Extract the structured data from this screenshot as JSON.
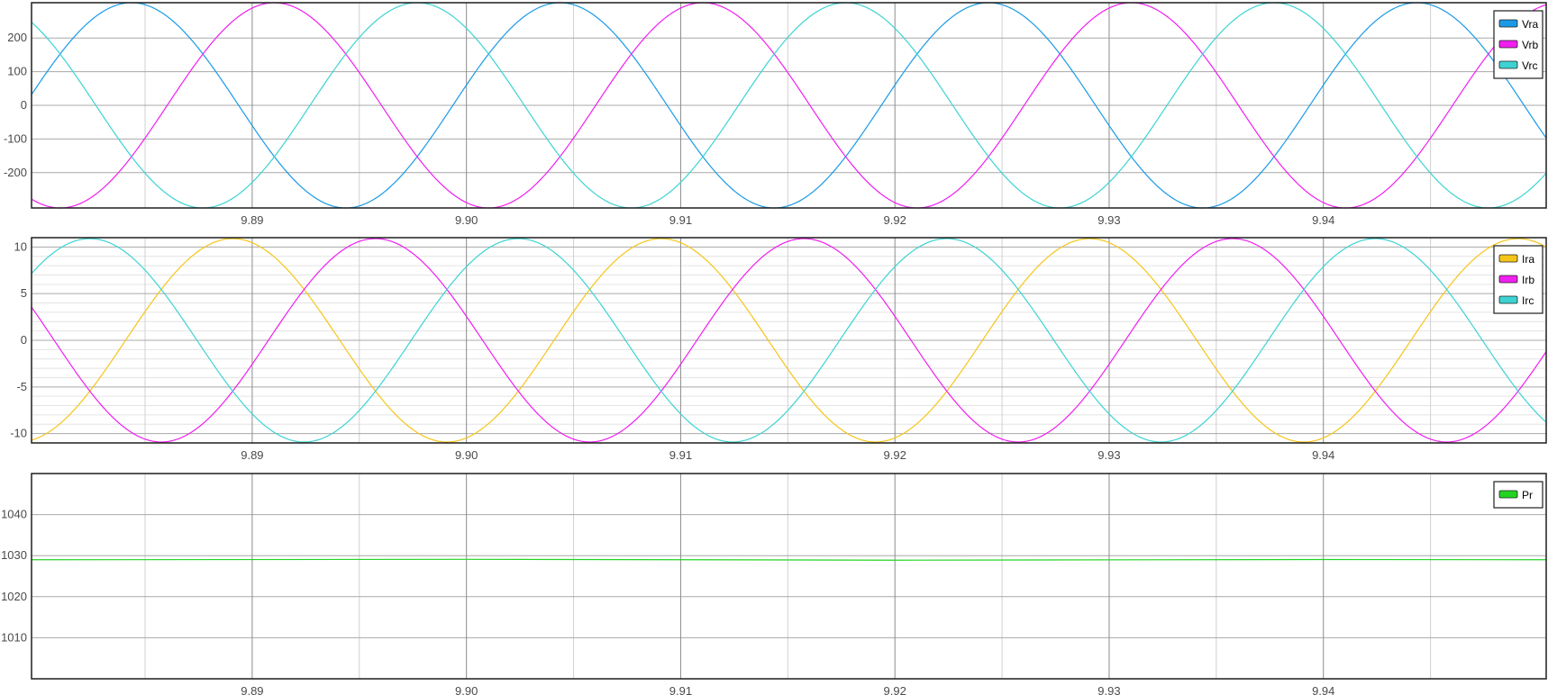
{
  "chart_data": [
    {
      "type": "line",
      "x_range": [
        9.8797,
        9.9504
      ],
      "x_ticks": [
        9.89,
        9.9,
        9.91,
        9.92,
        9.93,
        9.94
      ],
      "x_tick_labels": [
        "9.89",
        "9.90",
        "9.91",
        "9.92",
        "9.93",
        "9.94"
      ],
      "ylim": [
        -305,
        305
      ],
      "y_ticks": [
        200,
        100,
        0,
        -100,
        -200
      ],
      "y_tick_labels": [
        "200",
        "100",
        "0",
        "-100",
        "-200"
      ],
      "grid": true,
      "legend_position": "top-right",
      "series": [
        {
          "name": "Vra",
          "color": "#1a9ae6",
          "amplitude": 305,
          "frequency_hz": 50,
          "phase_deg": 6
        },
        {
          "name": "Vrb",
          "color": "#f01ef0",
          "amplitude": 305,
          "frequency_hz": 50,
          "phase_deg": -114
        },
        {
          "name": "Vrc",
          "color": "#3dd3d3",
          "amplitude": 305,
          "frequency_hz": 50,
          "phase_deg": 126
        }
      ]
    },
    {
      "type": "line",
      "x_range": [
        9.8797,
        9.9504
      ],
      "x_ticks": [
        9.89,
        9.9,
        9.91,
        9.92,
        9.93,
        9.94
      ],
      "x_tick_labels": [
        "9.89",
        "9.90",
        "9.91",
        "9.92",
        "9.93",
        "9.94"
      ],
      "ylim": [
        -11,
        11
      ],
      "y_ticks": [
        10,
        5,
        0,
        -5,
        -10
      ],
      "y_tick_labels": [
        "10",
        "5",
        "0",
        "-5",
        "-10"
      ],
      "minor_y_step": 1,
      "grid": true,
      "legend_position": "top-right",
      "series": [
        {
          "name": "Ira",
          "color": "#f5c518",
          "amplitude": 10.9,
          "frequency_hz": 50,
          "phase_deg": -79
        },
        {
          "name": "Irb",
          "color": "#f01ef0",
          "amplitude": 10.9,
          "frequency_hz": 50,
          "phase_deg": 161
        },
        {
          "name": "Irc",
          "color": "#3dd3d3",
          "amplitude": 10.9,
          "frequency_hz": 50,
          "phase_deg": 41
        }
      ]
    },
    {
      "type": "line",
      "x_range": [
        9.8797,
        9.9504
      ],
      "x_ticks": [
        9.89,
        9.9,
        9.91,
        9.92,
        9.93,
        9.94
      ],
      "x_tick_labels": [
        "9.89",
        "9.90",
        "9.91",
        "9.92",
        "9.93",
        "9.94"
      ],
      "ylim": [
        1000,
        1050
      ],
      "y_ticks": [
        1040,
        1030,
        1020,
        1010
      ],
      "y_tick_labels": [
        "1040",
        "1030",
        "1020",
        "1010"
      ],
      "grid": true,
      "legend_position": "top-right",
      "series": [
        {
          "name": "Pr",
          "color": "#22d422",
          "x": [
            9.8797,
            9.9,
            9.92,
            9.94,
            9.9504
          ],
          "y": [
            1029,
            1029.1,
            1028.9,
            1029.05,
            1029
          ]
        }
      ]
    }
  ]
}
